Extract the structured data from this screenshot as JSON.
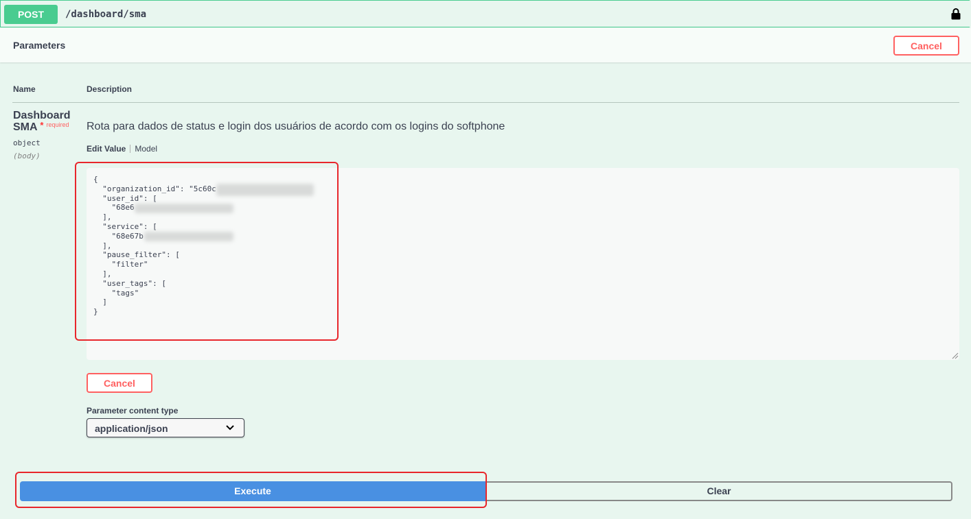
{
  "operation": {
    "method": "POST",
    "path": "/dashboard/sma"
  },
  "parameters_section": {
    "title": "Parameters",
    "cancel_label": "Cancel"
  },
  "table": {
    "col_name": "Name",
    "col_description": "Description"
  },
  "parameter": {
    "name_line1": "Dashboard",
    "name_line2": "SMA",
    "required_star": "*",
    "required_text": "required",
    "type": "object",
    "location": "(body)",
    "description": "Rota para dados de status e login dos usuários de acordo com os logins do softphone",
    "tab_edit": "Edit Value",
    "tab_model": "Model",
    "body_json_lines": [
      "{",
      "  \"organization_id\": \"5c60c",
      "  \"user_id\": [",
      "    \"68e6",
      "  ],",
      "  \"service\": [",
      "    \"68e67b",
      "  ],",
      "  \"pause_filter\": [",
      "    \"filter\"",
      "  ],",
      "  \"user_tags\": [",
      "    \"tags\"",
      "  ]",
      "}"
    ],
    "cancel_label": "Cancel",
    "content_type_label": "Parameter content type",
    "content_type_value": "application/json"
  },
  "actions": {
    "execute_label": "Execute",
    "clear_label": "Clear"
  },
  "colors": {
    "post_green": "#49cc90",
    "background": "#e8f6ef",
    "cancel_red": "#ff6060",
    "execute_blue": "#4990e2",
    "annotation_red": "#e8262b"
  },
  "icons": {
    "lock": "lock-icon",
    "chevron": "chevron-down-icon"
  }
}
